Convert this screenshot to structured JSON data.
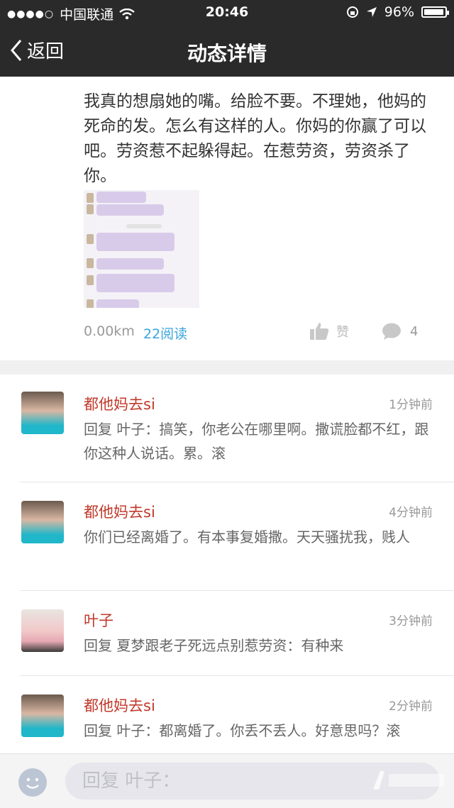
{
  "status_bar": {
    "carrier": "中国联通",
    "time": "20:46",
    "battery": "96%"
  },
  "nav": {
    "back_label": "返回",
    "title": "动态详情"
  },
  "post": {
    "text": "我真的想扇她的嘴。给脸不要。不理她，他妈的死命的发。怎么有这样的人。你妈的你赢了可以吧。劳资惹不起躲得起。在惹劳资，劳资杀了你。",
    "distance": "0.00km",
    "reads": "22阅读",
    "like_label": "赞",
    "comment_count": "4"
  },
  "comments": [
    {
      "name": "都他妈去si",
      "time": "1分钟前",
      "text": "回复 叶子：搞笑，你老公在哪里啊。撒谎脸都不红，跟你这种人说话。累。滚"
    },
    {
      "name": "都他妈去si",
      "time": "4分钟前",
      "text": "你们已经离婚了。有本事复婚撒。天天骚扰我，贱人"
    },
    {
      "name": "叶子",
      "time": "3分钟前",
      "text": "回复 夏梦跟老子死远点别惹劳资：有种来"
    },
    {
      "name": "都他妈去si",
      "time": "2分钟前",
      "text": "回复 叶子：都离婚了。你丢不丢人。好意思吗？滚"
    }
  ],
  "input": {
    "placeholder": "回复 叶子："
  },
  "colors": {
    "nav_bg": "#2a2a2a",
    "name": "#c0392b",
    "link": "#3aa5dc"
  }
}
